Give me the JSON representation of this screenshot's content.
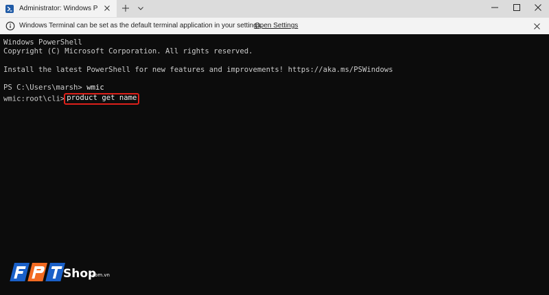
{
  "window": {
    "tab_title": "Administrator: Windows PowerShell",
    "tab_icon": "powershell-icon"
  },
  "infobar": {
    "message": "Windows Terminal can be set as the default terminal application in your settings.",
    "link": "Open Settings"
  },
  "terminal": {
    "lines": [
      "Windows PowerShell",
      "Copyright (C) Microsoft Corporation. All rights reserved.",
      "",
      "Install the latest PowerShell for new features and improvements! https://aka.ms/PSWindows",
      "",
      "PS C:\\Users\\marsh> "
    ],
    "prompt_command": "wmic",
    "wmic_prompt": "wmic:root\\cli>",
    "highlighted_command": "product get name"
  },
  "watermark": {
    "brand": "Shop",
    "domain": ".com.vn"
  },
  "colors": {
    "terminal_bg": "#0c0c0c",
    "terminal_text": "#cccccc",
    "highlight_border": "#e0211b",
    "logo_blue": "#1a60c8",
    "logo_orange": "#f26b22"
  }
}
